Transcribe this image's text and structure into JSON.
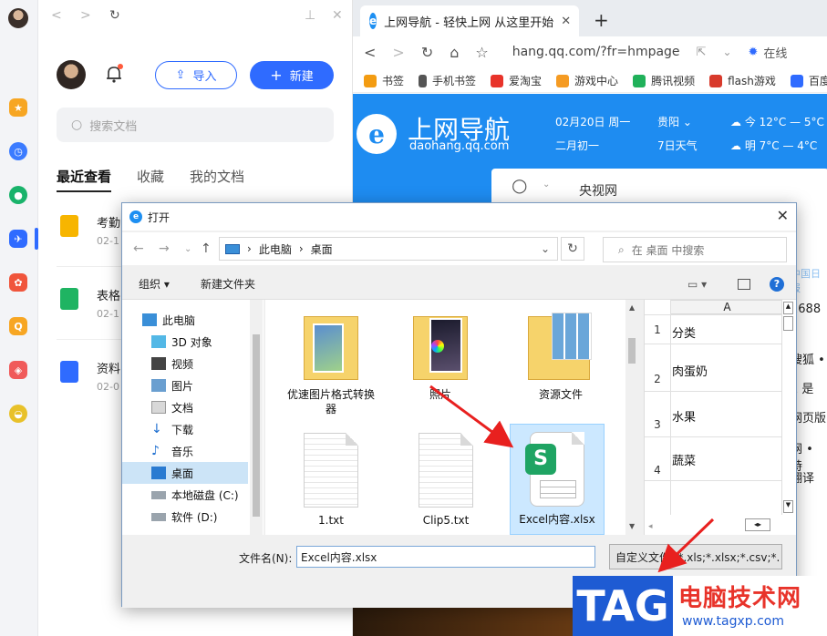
{
  "wps": {
    "import_label": "导入",
    "new_label": "新建",
    "search_placeholder": "搜索文档",
    "tabs": [
      "最近查看",
      "收藏",
      "我的文档"
    ],
    "recent": [
      {
        "name": "考勤",
        "date": "02-1",
        "color": "#f7b500"
      },
      {
        "name": "表格",
        "date": "02-1",
        "color": "#1fb462"
      },
      {
        "name": "资料",
        "date": "02-0",
        "color": "#2f6bff"
      }
    ]
  },
  "browser": {
    "tab_title": "上网导航 - 轻快上网 从这里开始",
    "url": "hang.qq.com/?fr=hmpage",
    "side_text": "在线",
    "bookmarks": [
      {
        "label": "书签",
        "color": "#f39c12"
      },
      {
        "label": "手机书签",
        "color": "#555555"
      },
      {
        "label": "爱淘宝",
        "color": "#e8332a"
      },
      {
        "label": "游戏中心",
        "color": "#f59b23"
      },
      {
        "label": "腾讯视频",
        "color": "#20b15a"
      },
      {
        "label": "flash游戏",
        "color": "#d83a2c"
      },
      {
        "label": "百度",
        "color": "#2f6bff"
      }
    ],
    "hero": {
      "logo_letter": "e",
      "title": "上网导航",
      "subtitle": "daohang.qq.com",
      "date": "02月20日 周一",
      "lunar": "二月初一",
      "city": "贵阳",
      "forecast": "7日天气",
      "today": "今 12°C — 5°C",
      "tomorrow": "明 7°C — 4°C",
      "search_text": "央视网"
    },
    "right_snippets": [
      "中国日报",
      "1688",
      "搜狐 •",
      "1 是 ",
      "网页版",
      "网 • 特",
      "翻译"
    ]
  },
  "dialog": {
    "title": "打开",
    "breadcrumb": [
      "此电脑",
      "桌面"
    ],
    "search_placeholder": "在 桌面 中搜索",
    "organize_label": "组织",
    "new_folder_label": "新建文件夹",
    "tree": [
      "此电脑",
      "3D 对象",
      "视频",
      "图片",
      "文档",
      "下载",
      "音乐",
      "桌面",
      "本地磁盘 (C:)",
      "软件 (D:)"
    ],
    "files": [
      {
        "name": "优速图片格式转换器",
        "kind": "folder"
      },
      {
        "name": "照片",
        "kind": "folder"
      },
      {
        "name": "资源文件",
        "kind": "folder"
      },
      {
        "name": "1.txt",
        "kind": "txt"
      },
      {
        "name": "Clip5.txt",
        "kind": "txt"
      },
      {
        "name": "Excel内容.xlsx",
        "kind": "xlsx"
      }
    ],
    "preview": {
      "column": "A",
      "rows": [
        {
          "num": "1",
          "value": "分类"
        },
        {
          "num": "2",
          "value": "肉蛋奶"
        },
        {
          "num": "3",
          "value": "水果"
        },
        {
          "num": "4",
          "value": "蔬菜"
        }
      ]
    },
    "filename_label": "文件名(N):",
    "filename_value": "Excel内容.xlsx",
    "filetype_value": "自定义文件 (*.xls;*.xlsx;*.csv;*."
  },
  "watermark": {
    "tag": "TAG",
    "site_name": "电脑技术网",
    "site_url": "www.tagxp.com"
  }
}
